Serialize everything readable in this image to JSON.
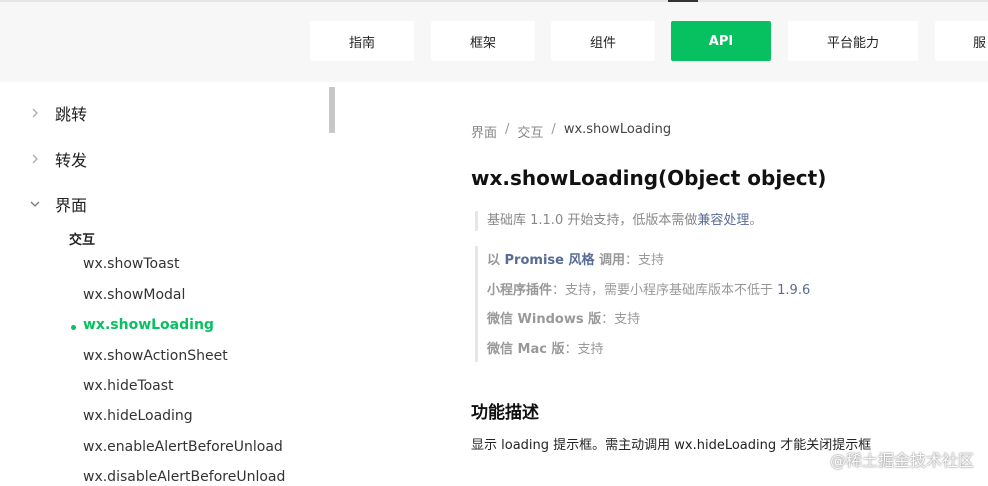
{
  "topnav": {
    "items": [
      {
        "label": "指南"
      },
      {
        "label": "框架"
      },
      {
        "label": "组件"
      },
      {
        "label": "API"
      },
      {
        "label": "平台能力"
      },
      {
        "label": "服"
      }
    ],
    "active": "API",
    "accent": "#07c160"
  },
  "sidebar": {
    "groups": [
      {
        "label": "跳转",
        "icon": "chevron-right-icon"
      },
      {
        "label": "转发",
        "icon": "chevron-right-icon"
      },
      {
        "label": "界面",
        "icon": "chevron-down-icon"
      }
    ],
    "subheading": "交互",
    "items": [
      {
        "label": "wx.showToast"
      },
      {
        "label": "wx.showModal"
      },
      {
        "label": "wx.showLoading"
      },
      {
        "label": "wx.showActionSheet"
      },
      {
        "label": "wx.hideToast"
      },
      {
        "label": "wx.hideLoading"
      },
      {
        "label": "wx.enableAlertBeforeUnload"
      },
      {
        "label": "wx.disableAlertBeforeUnload"
      }
    ],
    "active_item": "wx.showLoading"
  },
  "main": {
    "breadcrumb": [
      "界面",
      "交互",
      "wx.showLoading"
    ],
    "breadcrumb_sep": "/",
    "title": "wx.showLoading(Object object)",
    "support": {
      "prefix": "基础库 1.1.0 开始支持，低版本需做",
      "link": "兼容处理",
      "suffix": "。"
    },
    "compat": {
      "promise_prefix": "以 ",
      "promise_link": "Promise 风格",
      "promise_suffix_bold": " 调用",
      "promise_value": "：支持",
      "plugin_label": "小程序插件",
      "plugin_value": "：支持，需要小程序基础库版本不低于 ",
      "plugin_version": "1.9.6",
      "windows_label": "微信 Windows 版",
      "windows_value": "：支持",
      "mac_label": "微信 Mac 版",
      "mac_value": "：支持"
    },
    "section_title": "功能描述",
    "description": "显示 loading 提示框。需主动调用 wx.hideLoading 才能关闭提示框"
  },
  "watermark": "@稀土掘金技术社区"
}
